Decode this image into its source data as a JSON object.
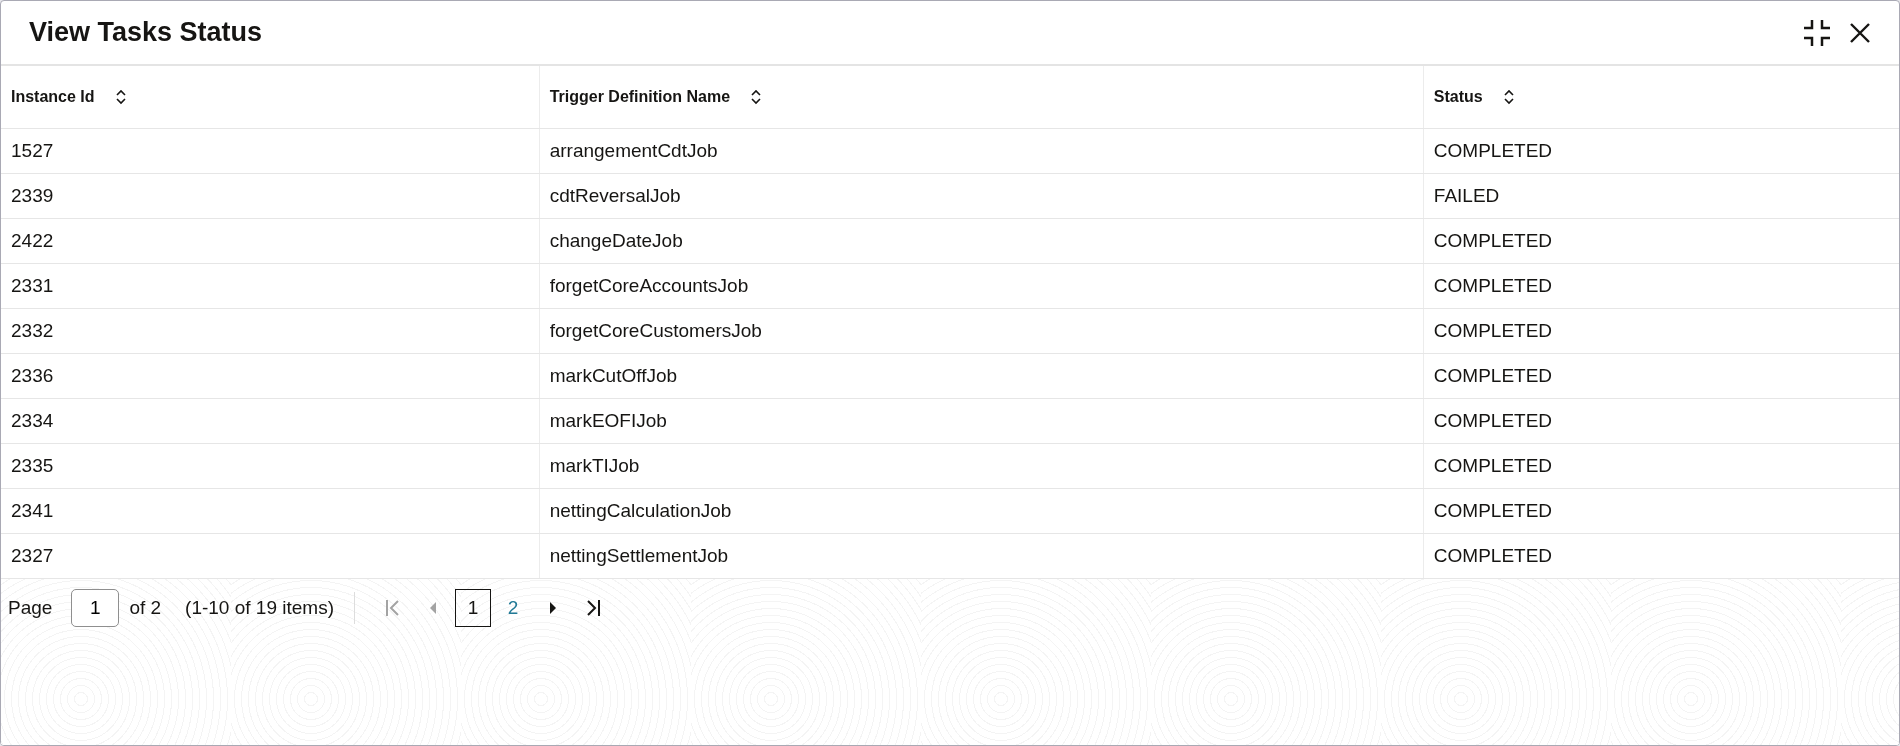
{
  "dialog": {
    "title": "View Tasks Status"
  },
  "table": {
    "columns": [
      {
        "label": "Instance Id",
        "sortable": true
      },
      {
        "label": "Trigger Definition Name",
        "sortable": true
      },
      {
        "label": "Status",
        "sortable": true
      }
    ],
    "rows": [
      [
        "1527",
        "arrangementCdtJob",
        "COMPLETED"
      ],
      [
        "2339",
        "cdtReversalJob",
        "FAILED"
      ],
      [
        "2422",
        "changeDateJob",
        "COMPLETED"
      ],
      [
        "2331",
        "forgetCoreAccountsJob",
        "COMPLETED"
      ],
      [
        "2332",
        "forgetCoreCustomersJob",
        "COMPLETED"
      ],
      [
        "2336",
        "markCutOffJob",
        "COMPLETED"
      ],
      [
        "2334",
        "markEOFIJob",
        "COMPLETED"
      ],
      [
        "2335",
        "markTIJob",
        "COMPLETED"
      ],
      [
        "2341",
        "nettingCalculationJob",
        "COMPLETED"
      ],
      [
        "2327",
        "nettingSettlementJob",
        "COMPLETED"
      ]
    ]
  },
  "pagination": {
    "page_label": "Page",
    "page_value": "1",
    "of_label": "of 2",
    "range": "(1-10 of 19 items)",
    "first": {
      "disabled": true
    },
    "previous": {
      "disabled": true
    },
    "pages": [
      {
        "label": "1",
        "selected": true
      },
      {
        "label": "2",
        "selected": false
      }
    ],
    "next": {
      "disabled": false
    },
    "last": {
      "disabled": false
    }
  }
}
